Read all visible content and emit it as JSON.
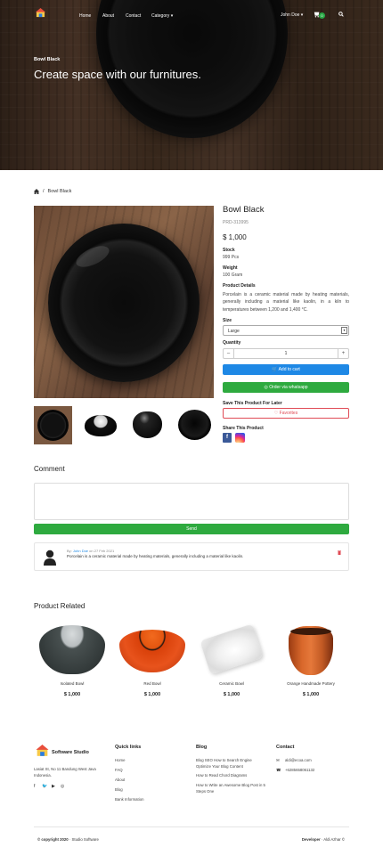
{
  "nav": {
    "items": [
      "Home",
      "About",
      "Contact",
      "Category"
    ],
    "user": "John Doe",
    "cart_count": "0"
  },
  "hero": {
    "subtitle": "Bowl Black",
    "title": "Create space with our furnitures."
  },
  "breadcrumb": {
    "current": "Bowl Black"
  },
  "product": {
    "title": "Bowl Black",
    "code": "PRD-313995",
    "price": "$ 1,000",
    "stock_label": "Stock",
    "stock_value": "999 Pcs",
    "weight_label": "Weight",
    "weight_value": "100 Gram",
    "details_label": "Product Details",
    "details": "Porcelain is a ceramic material made by heating materials, generally including a material like kaolin, in a kiln to temperatures between 1,200 and 1,400 °C.",
    "size_label": "Size",
    "size_value": "Large",
    "quantity_label": "Quantity",
    "quantity_value": "1",
    "add_to_cart": "Add to cart",
    "order_whatsapp": "Order via whatsapp",
    "save_later_label": "Save This Product For Later",
    "favorite": "Favorites",
    "share_label": "Share This Product"
  },
  "comments": {
    "title": "Comment",
    "send": "Send",
    "items": [
      {
        "by": "By:",
        "author": "John Doe",
        "on": "on 27 Feb 2021",
        "text": "Porcelain is a ceramic material made by heating materials, generally including a material like kaolin."
      }
    ]
  },
  "related": {
    "title": "Product Related",
    "items": [
      {
        "name": "Isolated Bowl",
        "price": "$ 1,000"
      },
      {
        "name": "Red Bowl",
        "price": "$ 1,000"
      },
      {
        "name": "Ceramic Bowl",
        "price": "$ 1,000"
      },
      {
        "name": "Orange Handmade Pottery",
        "price": "$ 1,000"
      }
    ]
  },
  "footer": {
    "brand": "Software Studio",
    "address": "Lasiat St, No 11 Bandung West Java Indonesia.",
    "quick_links_title": "Quick links",
    "quick_links": [
      "Home",
      "FAQ",
      "About",
      "Blog",
      "Bank Information"
    ],
    "blog_title": "Blog",
    "blog_links": [
      "Blog SEO How to Search Engine Optimize Your Blog Content",
      "How to Read Chord Diagrams",
      "How to Write an Awesome Blog Post in 5 Steps One"
    ],
    "contact_title": "Contact",
    "email": "aldi@ecoa.com",
    "phone": "+6285658061132",
    "copyright_prefix": "© copyright 2020",
    "copyright_suffix": "· Studio Software",
    "developer_prefix": "Developer",
    "developer_name": "· Aldi Azhar ©"
  },
  "colors": {
    "accent_blue": "#1e88e5",
    "whatsapp_green": "#2eaa3f",
    "favorite_red": "#e04b55"
  }
}
